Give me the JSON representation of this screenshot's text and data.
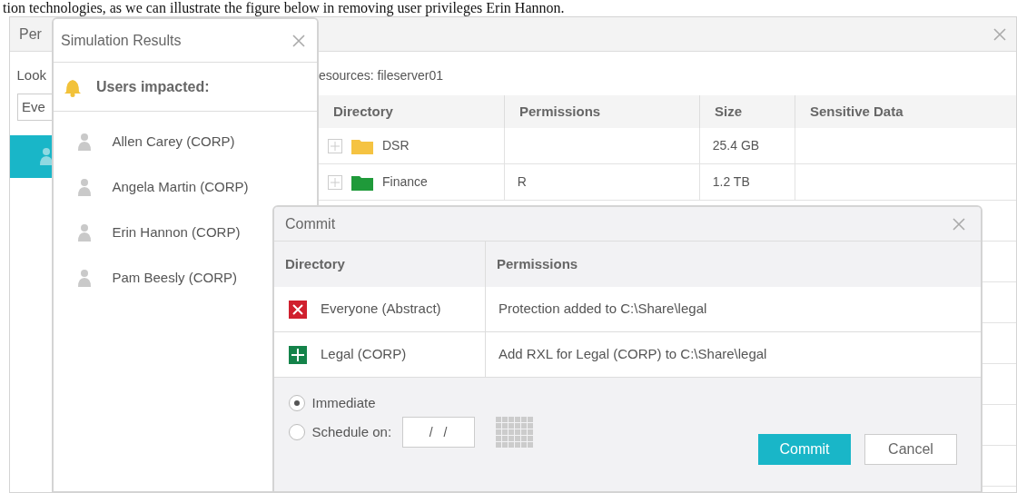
{
  "caption": "tion technologies, as we can illustrate the figure below in removing user privileges Erin Hannon.",
  "main_window": {
    "title": "Per",
    "lookup_label": "Look",
    "lookup_field": {
      "value": "Eve"
    },
    "sidebar_items": [
      {
        "selected": true
      }
    ],
    "resources_label": "esources: fileserver01",
    "table": {
      "columns": [
        "Directory",
        "Permissions",
        "Size",
        "Sensitive Data"
      ],
      "rows": [
        {
          "directory": "DSR",
          "color": "#f5c342",
          "size": "25.4 GB"
        },
        {
          "directory": "Finance",
          "color": "#1f9a3a",
          "permissions": "R",
          "size": "1.2 TB"
        }
      ]
    }
  },
  "simulation_dialog": {
    "title": "Simulation Results",
    "heading": "Users impacted:",
    "users": [
      "Allen Carey (CORP)",
      "Angela Martin (CORP)",
      "Erin Hannon (CORP)",
      "Pam Beesly (CORP)"
    ]
  },
  "commit_dialog": {
    "title": "Commit",
    "columns": [
      "Directory",
      "Permissions"
    ],
    "rows": [
      {
        "kind": "remove",
        "directory": "Everyone (Abstract)",
        "permissions": "Protection added to C:\\Share\\legal"
      },
      {
        "kind": "add",
        "directory": "Legal (CORP)",
        "permissions": "Add RXL for Legal (CORP) to C:\\Share\\legal"
      }
    ],
    "schedule_options": [
      {
        "label": "Immediate",
        "selected": true
      },
      {
        "label": "Schedule on:",
        "selected": false
      }
    ],
    "date_field": {
      "value": "/   /"
    },
    "buttons": [
      {
        "label": "Commit",
        "primary": true
      },
      {
        "label": "Cancel",
        "primary": false
      }
    ]
  }
}
